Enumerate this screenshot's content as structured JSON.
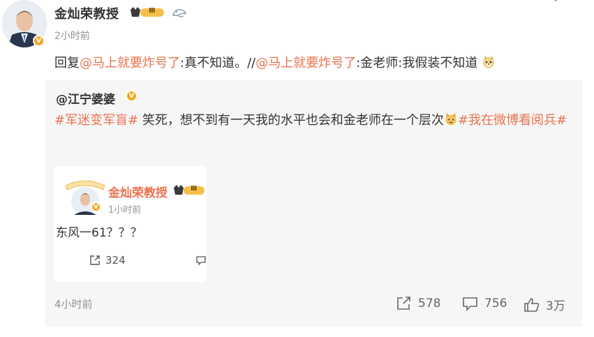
{
  "post": {
    "author": "金灿荣教授",
    "level_badge": "Ⅲ",
    "time": "2小时前",
    "reply_prefix": "回复",
    "mention1": "@马上就要炸号了",
    "text1": ":真不知道。//",
    "mention2": "@马上就要炸号了",
    "text2": ":金老师:我假装不知道"
  },
  "repost": {
    "author": "@江宁婆婆",
    "topic1": "#军迷变军盲#",
    "text": " 笑死，想不到有一天我的水平也会和金老师在一个层次",
    "topic2": "#我在微博看阅兵#",
    "time": "4小时前",
    "share_count": "578",
    "comment_count": "756",
    "like_count": "3万"
  },
  "card": {
    "author": "金灿荣教授",
    "level_badge": "Ⅲ",
    "time": "1小时前",
    "text": "东风一61？？？",
    "share_count": "324"
  },
  "colors": {
    "accent": "#eb7350",
    "muted": "#939393",
    "gold": "#f5a623"
  }
}
